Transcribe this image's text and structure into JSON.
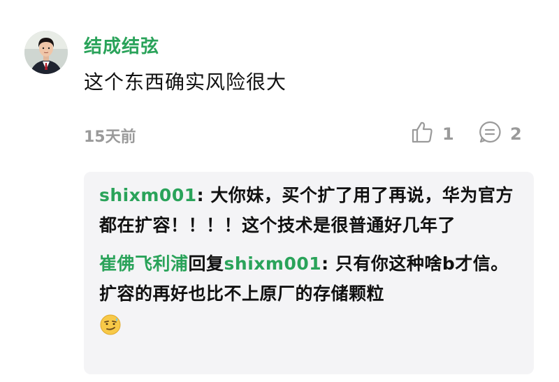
{
  "comment": {
    "username": "结成结弦",
    "text": "这个东西确实风险很大",
    "timestamp": "15天前",
    "likes": "1",
    "reply_count": "2"
  },
  "replies": [
    {
      "author": "shixm001",
      "separator": ": ",
      "text": "大你妹，买个扩了用了再说，华为官方都在扩容！！！！这个技术是很普通好几年了"
    },
    {
      "author": "崔佛飞利浦",
      "reply_word": "回复",
      "reply_to": "shixm001",
      "separator": ": ",
      "text": "只有你这种啥b才信。扩容的再好也比不上原厂的存储颗粒",
      "emoji": "smirk-emoji"
    }
  ],
  "colors": {
    "accent": "#2aa35a",
    "text": "#111111",
    "muted": "#9a9a9a",
    "reply_bg": "#f4f4f6"
  },
  "icons": {
    "like": "thumbs-up-icon",
    "reply": "comment-bubble-icon"
  }
}
